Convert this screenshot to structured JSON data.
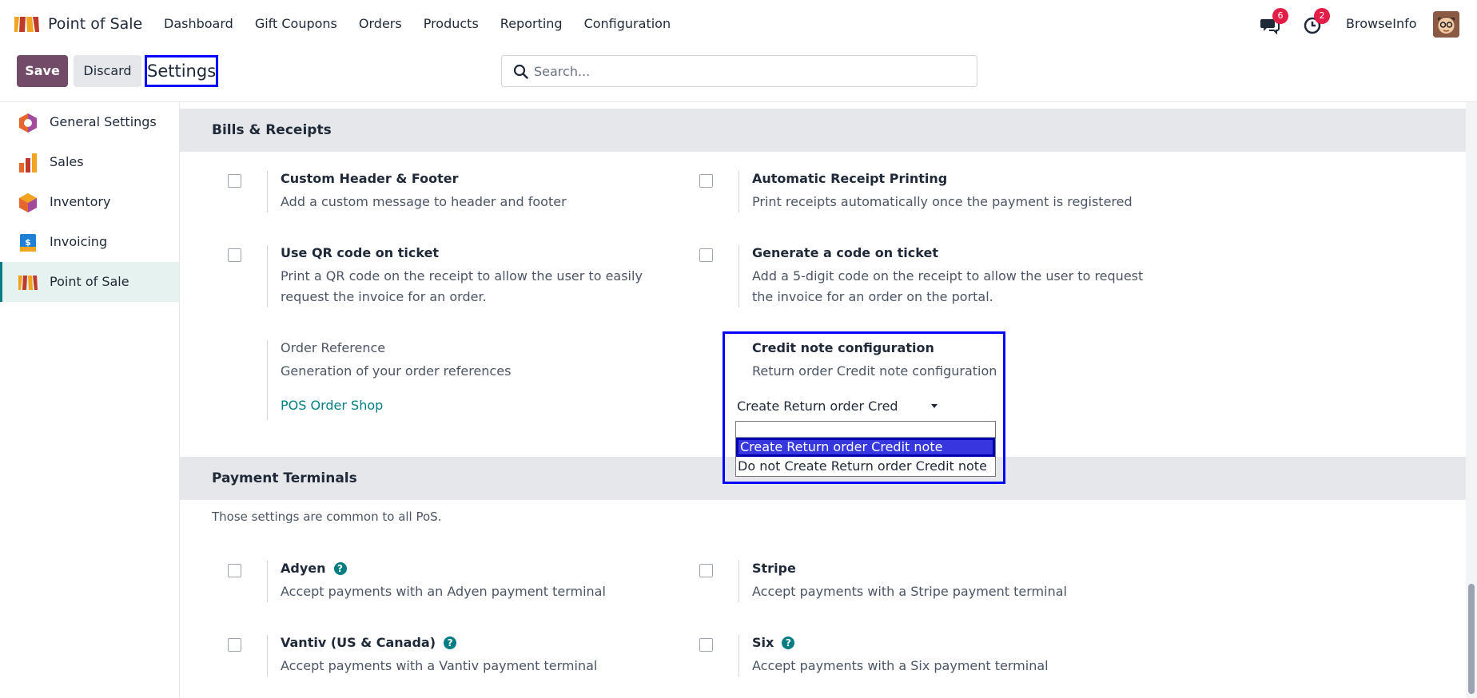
{
  "app": {
    "name": "Point of Sale",
    "menu": [
      "Dashboard",
      "Gift Coupons",
      "Orders",
      "Products",
      "Reporting",
      "Configuration"
    ],
    "messages_count": "6",
    "activities_count": "2",
    "company": "BrowseInfo"
  },
  "control_panel": {
    "save_label": "Save",
    "discard_label": "Discard",
    "title": "Settings",
    "search_placeholder": "Search..."
  },
  "sidebar": {
    "items": [
      {
        "label": "General Settings",
        "icon": "settings-hex-icon"
      },
      {
        "label": "Sales",
        "icon": "sales-chart-icon"
      },
      {
        "label": "Inventory",
        "icon": "inventory-box-icon"
      },
      {
        "label": "Invoicing",
        "icon": "invoice-dollar-icon"
      },
      {
        "label": "Point of Sale",
        "icon": "pos-shop-icon",
        "active": true
      }
    ]
  },
  "bills": {
    "title": "Bills & Receipts",
    "custom_header": {
      "title": "Custom Header & Footer",
      "desc": "Add a custom message to header and footer"
    },
    "auto_print": {
      "title": "Automatic Receipt Printing",
      "desc": "Print receipts automatically once the payment is registered"
    },
    "qr_code": {
      "title": "Use QR code on ticket",
      "desc": "Print a QR code on the receipt to allow the user to easily request the invoice for an order."
    },
    "gen_code": {
      "title": "Generate a code on ticket",
      "desc": "Add a 5-digit code on the receipt to allow the user to request the invoice for an order on the portal."
    },
    "order_ref": {
      "title": "Order Reference",
      "desc": "Generation of your order references",
      "link": "POS Order Shop"
    },
    "credit_note": {
      "title": "Credit note configuration",
      "desc": "Return order Credit note configuration",
      "selected": "Create Return order Credit no",
      "options": [
        "Create Return order Credit note",
        "Do not Create Return order Credit note"
      ]
    }
  },
  "payment": {
    "title": "Payment Terminals",
    "note": "Those settings are common to all PoS.",
    "adyen": {
      "title": "Adyen",
      "desc": "Accept payments with an Adyen payment terminal"
    },
    "stripe": {
      "title": "Stripe",
      "desc": "Accept payments with a Stripe payment terminal"
    },
    "vantiv": {
      "title": "Vantiv (US & Canada)",
      "desc": "Accept payments with a Vantiv payment terminal"
    },
    "six": {
      "title": "Six",
      "desc": "Accept payments with a Six payment terminal"
    }
  },
  "colors": {
    "brand": "#714b67",
    "accent": "#017e84",
    "highlight": "#0000ff"
  }
}
